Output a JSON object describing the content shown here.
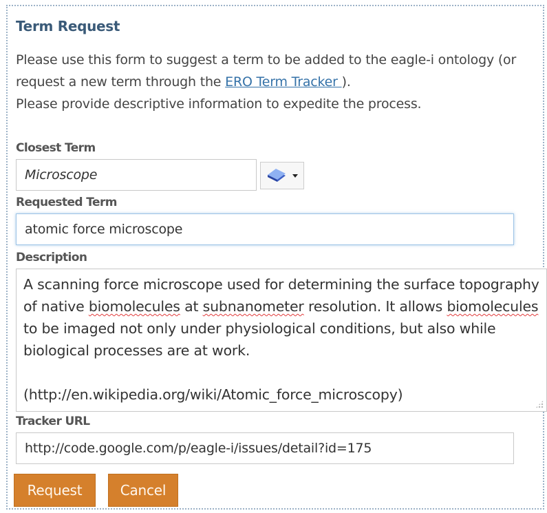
{
  "panel": {
    "title": "Term Request",
    "intro_before_link": "Please use this form to suggest a term to be added to the eagle-i ontology (or request a new term through the ",
    "intro_link": "ERO Term Tracker ",
    "intro_after_link": ").",
    "intro_line3": "Please provide descriptive information to expedite the process."
  },
  "closest_term": {
    "label": "Closest Term",
    "value": "Microscope",
    "picker_icon": "book-icon"
  },
  "requested_term": {
    "label": "Requested Term",
    "value": "atomic force microscope"
  },
  "description": {
    "label": "Description",
    "seg1": "A scanning force microscope used for determining the surface topography of native ",
    "seg2": "biomolecules",
    "seg3": " at ",
    "seg4": "subnanometer",
    "seg5": " resolution. It allows ",
    "seg6": "biomolecules",
    "seg7": " to be imaged not only under physiological conditions, but also while biological processes are at work.\n\n(http://en.wikipedia.org/wiki/Atomic_force_microscopy)"
  },
  "tracker_url": {
    "label": "Tracker URL",
    "value": "http://code.google.com/p/eagle-i/issues/detail?id=175"
  },
  "actions": {
    "request_label": "Request",
    "cancel_label": "Cancel"
  },
  "colors": {
    "accent": "#d5802c",
    "title": "#3a5a78",
    "link": "#3572a8",
    "spellcheck": "#e23b3b"
  }
}
